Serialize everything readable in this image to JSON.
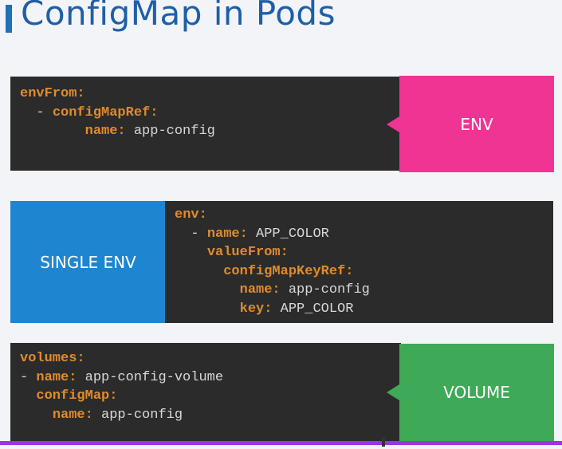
{
  "title": "ConfigMap in Pods",
  "colors": {
    "title": "#1e5fa8",
    "code_bg": "#2b2b2b",
    "code_key": "#e08b2e",
    "env_tag": "#f03494",
    "single_env_tag": "#1e86d0",
    "volume_tag": "#3eaa57",
    "bottom_line": "#a033e0"
  },
  "block1": {
    "tag": "ENV",
    "l1_key": "envFrom:",
    "l2_dash": "  - ",
    "l2_key": "configMapRef:",
    "l3_indent": "        ",
    "l3_key": "name:",
    "l3_val": " app-config"
  },
  "block2": {
    "tag": "SINGLE ENV",
    "l1_key": "env:",
    "l2_dash": "  - ",
    "l2_key": "name:",
    "l2_val": " APP_COLOR",
    "l3_indent": "    ",
    "l3_key": "valueFrom:",
    "l4_indent": "      ",
    "l4_key": "configMapKeyRef:",
    "l5_indent": "        ",
    "l5_key": "name:",
    "l5_val": " app-config",
    "l6_indent": "        ",
    "l6_key": "key:",
    "l6_val": " APP_COLOR"
  },
  "block3": {
    "tag": "VOLUME",
    "l1_key": "volumes:",
    "l2_dash": "- ",
    "l2_key": "name:",
    "l2_val": " app-config-volume",
    "l3_indent": "  ",
    "l3_key": "configMap:",
    "l4_indent": "    ",
    "l4_key": "name:",
    "l4_val": " app-config"
  }
}
